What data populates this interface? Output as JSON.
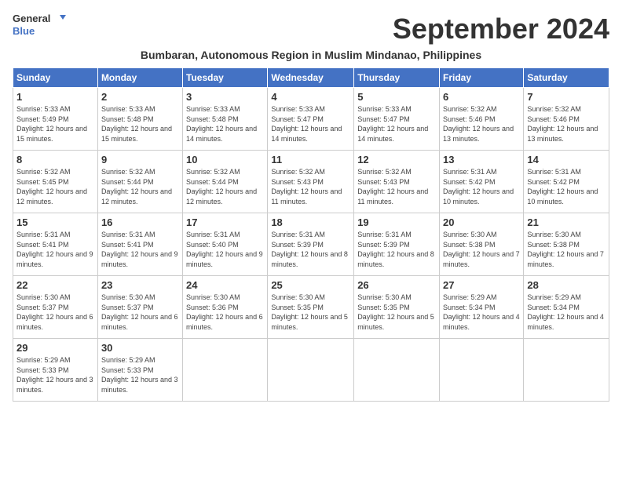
{
  "logo": {
    "line1": "General",
    "line2": "Blue"
  },
  "title": "September 2024",
  "subtitle": "Bumbaran, Autonomous Region in Muslim Mindanao, Philippines",
  "days_header": [
    "Sunday",
    "Monday",
    "Tuesday",
    "Wednesday",
    "Thursday",
    "Friday",
    "Saturday"
  ],
  "weeks": [
    [
      {
        "day": "1",
        "sunrise": "5:33 AM",
        "sunset": "5:49 PM",
        "daylight": "12 hours and 15 minutes."
      },
      {
        "day": "2",
        "sunrise": "5:33 AM",
        "sunset": "5:48 PM",
        "daylight": "12 hours and 15 minutes."
      },
      {
        "day": "3",
        "sunrise": "5:33 AM",
        "sunset": "5:48 PM",
        "daylight": "12 hours and 14 minutes."
      },
      {
        "day": "4",
        "sunrise": "5:33 AM",
        "sunset": "5:47 PM",
        "daylight": "12 hours and 14 minutes."
      },
      {
        "day": "5",
        "sunrise": "5:33 AM",
        "sunset": "5:47 PM",
        "daylight": "12 hours and 14 minutes."
      },
      {
        "day": "6",
        "sunrise": "5:32 AM",
        "sunset": "5:46 PM",
        "daylight": "12 hours and 13 minutes."
      },
      {
        "day": "7",
        "sunrise": "5:32 AM",
        "sunset": "5:46 PM",
        "daylight": "12 hours and 13 minutes."
      }
    ],
    [
      {
        "day": "8",
        "sunrise": "5:32 AM",
        "sunset": "5:45 PM",
        "daylight": "12 hours and 12 minutes."
      },
      {
        "day": "9",
        "sunrise": "5:32 AM",
        "sunset": "5:44 PM",
        "daylight": "12 hours and 12 minutes."
      },
      {
        "day": "10",
        "sunrise": "5:32 AM",
        "sunset": "5:44 PM",
        "daylight": "12 hours and 12 minutes."
      },
      {
        "day": "11",
        "sunrise": "5:32 AM",
        "sunset": "5:43 PM",
        "daylight": "12 hours and 11 minutes."
      },
      {
        "day": "12",
        "sunrise": "5:32 AM",
        "sunset": "5:43 PM",
        "daylight": "12 hours and 11 minutes."
      },
      {
        "day": "13",
        "sunrise": "5:31 AM",
        "sunset": "5:42 PM",
        "daylight": "12 hours and 10 minutes."
      },
      {
        "day": "14",
        "sunrise": "5:31 AM",
        "sunset": "5:42 PM",
        "daylight": "12 hours and 10 minutes."
      }
    ],
    [
      {
        "day": "15",
        "sunrise": "5:31 AM",
        "sunset": "5:41 PM",
        "daylight": "12 hours and 9 minutes."
      },
      {
        "day": "16",
        "sunrise": "5:31 AM",
        "sunset": "5:41 PM",
        "daylight": "12 hours and 9 minutes."
      },
      {
        "day": "17",
        "sunrise": "5:31 AM",
        "sunset": "5:40 PM",
        "daylight": "12 hours and 9 minutes."
      },
      {
        "day": "18",
        "sunrise": "5:31 AM",
        "sunset": "5:39 PM",
        "daylight": "12 hours and 8 minutes."
      },
      {
        "day": "19",
        "sunrise": "5:31 AM",
        "sunset": "5:39 PM",
        "daylight": "12 hours and 8 minutes."
      },
      {
        "day": "20",
        "sunrise": "5:30 AM",
        "sunset": "5:38 PM",
        "daylight": "12 hours and 7 minutes."
      },
      {
        "day": "21",
        "sunrise": "5:30 AM",
        "sunset": "5:38 PM",
        "daylight": "12 hours and 7 minutes."
      }
    ],
    [
      {
        "day": "22",
        "sunrise": "5:30 AM",
        "sunset": "5:37 PM",
        "daylight": "12 hours and 6 minutes."
      },
      {
        "day": "23",
        "sunrise": "5:30 AM",
        "sunset": "5:37 PM",
        "daylight": "12 hours and 6 minutes."
      },
      {
        "day": "24",
        "sunrise": "5:30 AM",
        "sunset": "5:36 PM",
        "daylight": "12 hours and 6 minutes."
      },
      {
        "day": "25",
        "sunrise": "5:30 AM",
        "sunset": "5:35 PM",
        "daylight": "12 hours and 5 minutes."
      },
      {
        "day": "26",
        "sunrise": "5:30 AM",
        "sunset": "5:35 PM",
        "daylight": "12 hours and 5 minutes."
      },
      {
        "day": "27",
        "sunrise": "5:29 AM",
        "sunset": "5:34 PM",
        "daylight": "12 hours and 4 minutes."
      },
      {
        "day": "28",
        "sunrise": "5:29 AM",
        "sunset": "5:34 PM",
        "daylight": "12 hours and 4 minutes."
      }
    ],
    [
      {
        "day": "29",
        "sunrise": "5:29 AM",
        "sunset": "5:33 PM",
        "daylight": "12 hours and 3 minutes."
      },
      {
        "day": "30",
        "sunrise": "5:29 AM",
        "sunset": "5:33 PM",
        "daylight": "12 hours and 3 minutes."
      },
      null,
      null,
      null,
      null,
      null
    ]
  ]
}
